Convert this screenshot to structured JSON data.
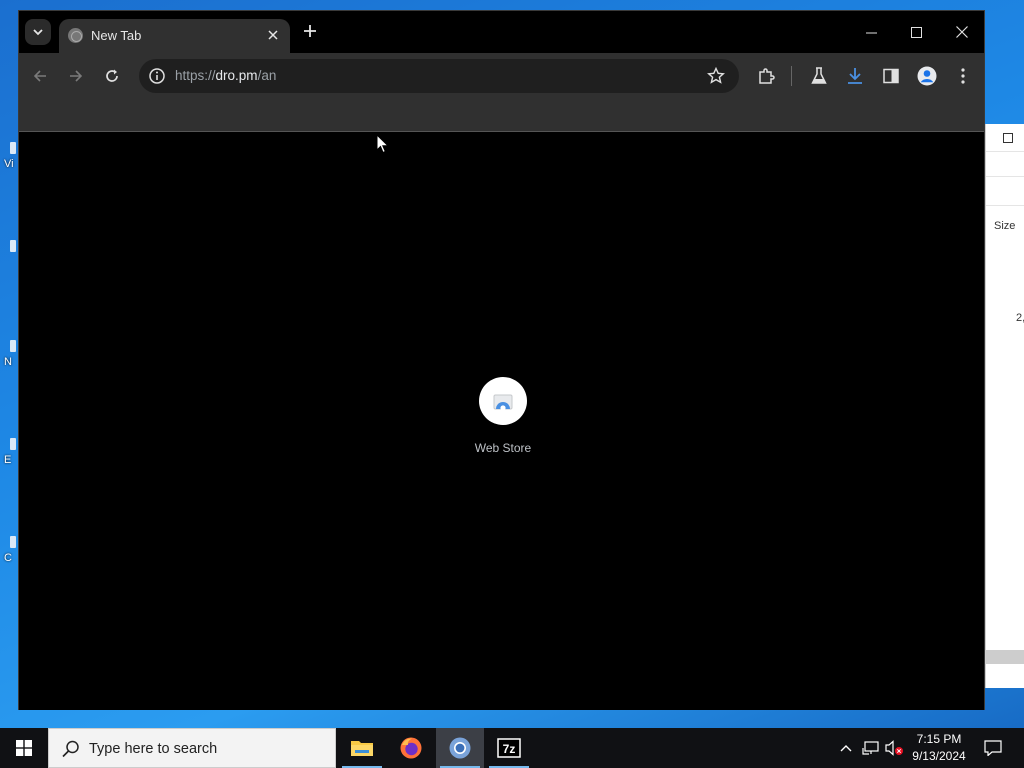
{
  "desktop": {
    "icons": [
      {
        "label": "Vi"
      },
      {
        "label": ""
      },
      {
        "label": "N"
      },
      {
        "label": "E"
      },
      {
        "label": "C"
      }
    ]
  },
  "background_window": {
    "column_header": "Size",
    "cell_value": "2,"
  },
  "browser": {
    "tab": {
      "title": "New Tab"
    },
    "address_bar": {
      "url_prefix": "https://",
      "url_host": "dro.pm",
      "url_path": "/an"
    },
    "shortcuts": [
      {
        "label": "Web Store",
        "icon": "web-store-icon"
      }
    ],
    "colors": {
      "accent": "#1a73e8",
      "download_icon": "#4a90e2"
    }
  },
  "taskbar": {
    "search_placeholder": "Type here to search",
    "apps": [
      {
        "name": "File Explorer",
        "icon": "folder-icon"
      },
      {
        "name": "Firefox",
        "icon": "firefox-icon"
      },
      {
        "name": "Chrome",
        "icon": "chrome-icon"
      },
      {
        "name": "7-Zip",
        "icon": "7zip-icon",
        "label": "7z"
      }
    ],
    "clock": {
      "time": "7:15 PM",
      "date": "9/13/2024"
    }
  }
}
